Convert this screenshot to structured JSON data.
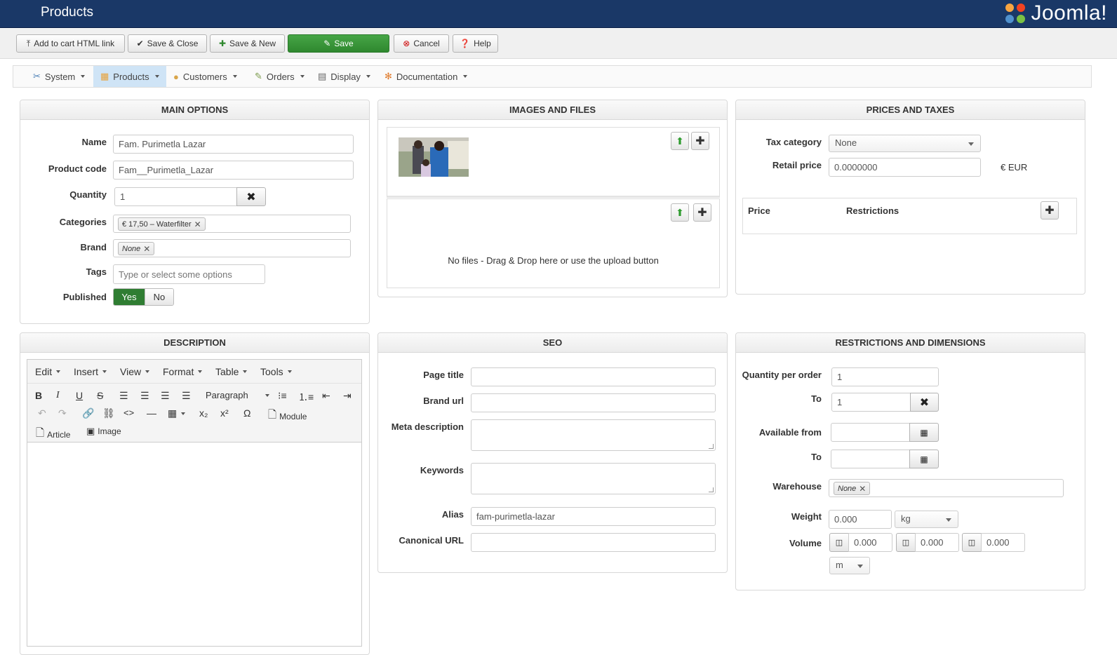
{
  "header": {
    "title": "Products",
    "logo_text": "Joomla!"
  },
  "toolbar": {
    "add_cart_html": "Add to cart HTML link",
    "save_close": "Save & Close",
    "save_new": "Save & New",
    "save": "Save",
    "cancel": "Cancel",
    "help": "Help"
  },
  "menu": {
    "items": [
      {
        "label": "System"
      },
      {
        "label": "Products"
      },
      {
        "label": "Customers"
      },
      {
        "label": "Orders"
      },
      {
        "label": "Display"
      },
      {
        "label": "Documentation"
      }
    ]
  },
  "main_options": {
    "heading": "MAIN OPTIONS",
    "name_label": "Name",
    "name_value": "Fam. Purimetla Lazar",
    "code_label": "Product code",
    "code_value": "Fam__Purimetla_Lazar",
    "qty_label": "Quantity",
    "qty_value": "1",
    "categories_label": "Categories",
    "category_chip": "€ 17,50 – Waterfilter",
    "brand_label": "Brand",
    "brand_chip": "None",
    "tags_label": "Tags",
    "tags_placeholder": "Type or select some options",
    "published_label": "Published",
    "yes": "Yes",
    "no": "No"
  },
  "images": {
    "heading": "IMAGES AND FILES",
    "no_files": "No files - Drag & Drop here or use the upload button"
  },
  "prices": {
    "heading": "PRICES AND TAXES",
    "tax_label": "Tax category",
    "tax_value": "None",
    "retail_label": "Retail price",
    "retail_value": "0.0000000",
    "currency": "€ EUR",
    "col_price": "Price",
    "col_restrictions": "Restrictions"
  },
  "description": {
    "heading": "DESCRIPTION",
    "menus": [
      "Edit",
      "Insert",
      "View",
      "Format",
      "Table",
      "Tools"
    ],
    "paragraph": "Paragraph",
    "module": "Module",
    "article": "Article",
    "image": "Image"
  },
  "seo": {
    "heading": "SEO",
    "page_title_label": "Page title",
    "brand_url_label": "Brand url",
    "meta_label": "Meta description",
    "keywords_label": "Keywords",
    "alias_label": "Alias",
    "alias_value": "fam-purimetla-lazar",
    "canonical_label": "Canonical URL"
  },
  "restrictions": {
    "heading": "RESTRICTIONS AND DIMENSIONS",
    "qty_order_label": "Quantity per order",
    "qty_order_value": "1",
    "to_label": "To",
    "to_value": "1",
    "available_label": "Available from",
    "to2_label": "To",
    "warehouse_label": "Warehouse",
    "warehouse_chip": "None",
    "weight_label": "Weight",
    "weight_value": "0.000",
    "weight_unit": "kg",
    "volume_label": "Volume",
    "vol1": "0.000",
    "vol2": "0.000",
    "vol3": "0.000",
    "volume_unit": "m"
  }
}
